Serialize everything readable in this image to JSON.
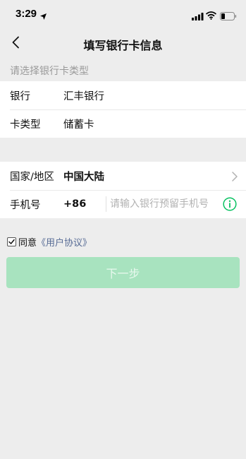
{
  "status_bar": {
    "time": "3:29",
    "icons": [
      "location-arrow-icon",
      "signal-icon",
      "wifi-icon",
      "battery-icon"
    ]
  },
  "nav": {
    "title": "填写银行卡信息",
    "back_icon": "chevron-left-icon"
  },
  "section_hint": "请选择银行卡类型",
  "card_info": {
    "bank_label": "银行",
    "bank_value": "汇丰银行",
    "card_type_label": "卡类型",
    "card_type_value": "储蓄卡"
  },
  "contact_info": {
    "region_label": "国家/地区",
    "region_value": "中国大陆",
    "phone_label": "手机号",
    "phone_code": "+86",
    "phone_value": "",
    "phone_placeholder": "请输入银行预留手机号",
    "info_icon": "info-circle-icon"
  },
  "agreement": {
    "checked": true,
    "text": "同意",
    "link": "《用户协议》"
  },
  "next_button": {
    "label": "下一步",
    "disabled": true
  },
  "colors": {
    "background": "#ededed",
    "accent_green": "#07c160",
    "disabled_button": "#a8e3bf",
    "link_blue": "#576b95"
  }
}
